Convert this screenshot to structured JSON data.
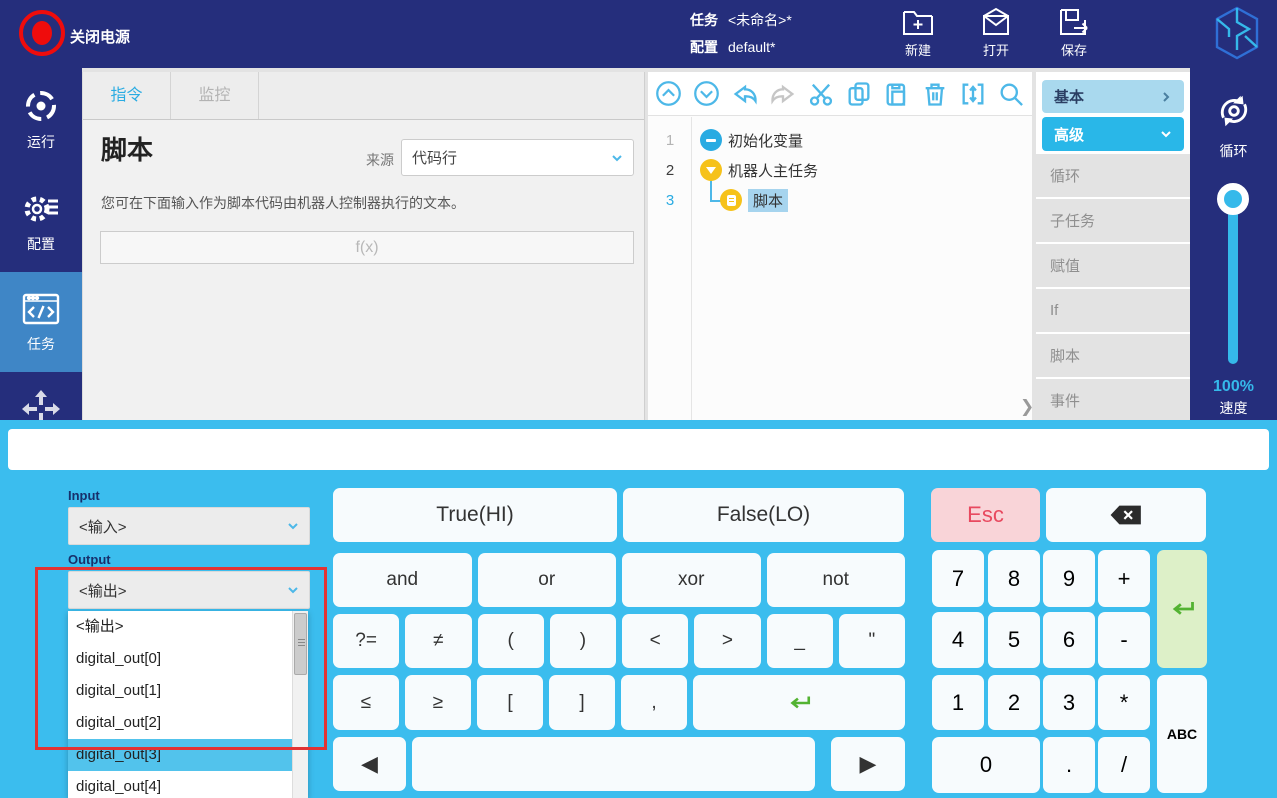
{
  "colors": {
    "navy": "#252e7c",
    "accent_cyan": "#29abe2",
    "keyboard_bg": "#3bbdee",
    "advanced_bg": "#29b7e8",
    "basic_bg": "#a9d9ee",
    "esc_bg": "#f9d4d8",
    "esc_text": "#e8495f",
    "enter_bg": "#ddf0c8",
    "enter_arrow": "#53b332",
    "dropdown_highlight": "#52c3ec",
    "tree_highlight": "#a6d4ee",
    "annotation_red": "#e23333",
    "sidebar_active": "#3f86c6"
  },
  "topbar": {
    "shutdown_label": "关闭电源",
    "task_label": "任务",
    "task_value": "<未命名>*",
    "config_label": "配置",
    "config_value": "default*",
    "new_label": "新建",
    "open_label": "打开",
    "save_label": "保存"
  },
  "sidebar": {
    "run_label": "运行",
    "config_label": "配置",
    "task_label": "任务"
  },
  "main": {
    "tab_instruction": "指令",
    "tab_monitor": "监控",
    "title": "脚本",
    "source_label": "来源",
    "source_value": "代码行",
    "description": "您可在下面输入作为脚本代码由机器人控制器执行的文本。",
    "expression_placeholder": "f(x)"
  },
  "tree": {
    "rows": [
      {
        "line": "1",
        "label": "初始化变量"
      },
      {
        "line": "2",
        "label": "机器人主任务"
      },
      {
        "line": "3",
        "label": "脚本"
      }
    ],
    "expand_chevron": "❯"
  },
  "palette": {
    "basic": "基本",
    "advanced": "高级",
    "items": [
      "循环",
      "子任务",
      "赋值",
      "If",
      "脚本",
      "事件"
    ]
  },
  "rightbar": {
    "loop_label": "循环",
    "speed_value": "100%",
    "speed_label": "速度"
  },
  "keyboard": {
    "text_input_value": "",
    "input_label": "Input",
    "input_value": "<输入>",
    "output_label": "Output",
    "output_value": "<输出>",
    "output_options": [
      "<输出>",
      "digital_out[0]",
      "digital_out[1]",
      "digital_out[2]",
      "digital_out[3]",
      "digital_out[4]"
    ],
    "highlighted_option": "digital_out[3]",
    "keys": {
      "true_key": "True(HI)",
      "false_key": "False(LO)",
      "esc": "Esc",
      "logic": [
        "and",
        "or",
        "xor",
        "not"
      ],
      "symbols": [
        "?=",
        "≠",
        "(",
        ")",
        "<",
        ">",
        "_",
        "\""
      ],
      "brackets": [
        "≤",
        "≥",
        "[",
        "]",
        ","
      ],
      "left_arrow": "◀",
      "right_arrow": "▶",
      "digits_row1": [
        "7",
        "8",
        "9",
        "+"
      ],
      "digits_row2": [
        "4",
        "5",
        "6",
        "-"
      ],
      "digits_row3": [
        "1",
        "2",
        "3",
        "*"
      ],
      "zero": "0",
      "dot": ".",
      "slash": "/",
      "abc": "ABC"
    }
  }
}
